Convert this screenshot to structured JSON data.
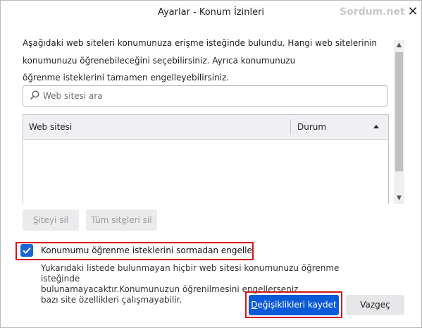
{
  "window": {
    "title": "Ayarlar - Konum İzinleri",
    "watermark": "Sordum.net",
    "close_label": "✕"
  },
  "description": {
    "line1": "Aşağıdaki web siteleri konumunuza erişme isteğinde bulundu. Hangi web sitelerinin",
    "line2": "konumunuzu öğrenebileceğini seçebilirsiniz. Ayrıca konumunuzu",
    "line3": "öğrenme isteklerini tamamen engelleyebilirsiniz."
  },
  "search": {
    "placeholder": "Web sitesi ara",
    "value": ""
  },
  "table": {
    "columns": [
      "Web sitesi",
      "Durum"
    ],
    "rows": []
  },
  "buttons": {
    "remove_site_prefix": "",
    "remove_site_access": "S",
    "remove_site_rest": "iteyi sil",
    "remove_all_prefix": "Tüm sit",
    "remove_all_access": "e",
    "remove_all_rest": "leri sil",
    "save_prefix": "",
    "save_access": "D",
    "save_rest": "eğişiklikleri kaydet",
    "cancel": "Vazgeç"
  },
  "block_option": {
    "label": "Konumumu öğrenme isteklerini sormadan engelle",
    "checked": true,
    "note_line1": "Yukarıdaki listede bulunmayan hiçbir web sitesi konumunuzu öğrenme isteğinde",
    "note_line2": "bulunamayacaktır.Konumunuzun öğrenilmesini engellerseniz",
    "note_line3": "bazı site özellikleri çalışmayabilir."
  },
  "colors": {
    "accent": "#0a5ad8",
    "highlight": "#d4151d",
    "checkbox": "#1a64d8"
  }
}
